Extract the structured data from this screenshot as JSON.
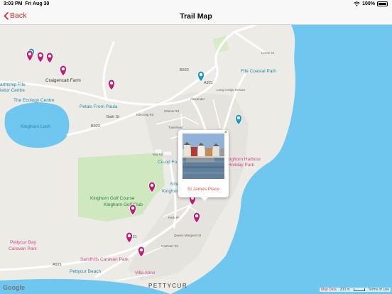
{
  "status": {
    "time": "3:03 PM",
    "date": "Fri Aug 30",
    "battery": "100%"
  },
  "nav": {
    "back_label": "Back",
    "title": "Trail Map"
  },
  "map": {
    "labels": {
      "craigencalt": "Craigencalt Farm",
      "earthship": "arthship Fife",
      "visitor": "isitor Centre",
      "ecology": "The Ecology Centre",
      "petals": "Petals From Paula",
      "loch": "Kinghorn Loch",
      "fife_coastal": "Fife Coastal Path",
      "coop": "Co-op Fo",
      "harbour1": "Kinghorn Harbour",
      "harbour2": "Holiday Park",
      "kinghorn_partial": "Kingh",
      "kinghorn_beach": "Kinghorn Bea",
      "golf_course": "Kinghorn Golf Course",
      "golf_club": "Kinghorn Golf Club",
      "pettycur_bay1": "Pettycur Bay",
      "pettycur_bay2": "Caravan Park",
      "sandhills": "Sandhills Caravan Park",
      "pettycur_beach": "Pettycur Beach",
      "villa": "Villa Atina",
      "pettycur_town": "PETTYCUR",
      "b923_a": "B923",
      "b923_b": "B923",
      "bath_st": "Bath St",
      "a921_a": "A921",
      "a921_b": "A921",
      "a921_c": "A921",
      "links_st": "Linton Ct",
      "long_craigs": "Long Craigs Terrace",
      "kirk_rd": "Kilncraig Rd",
      "mid_rd": "Mid Rd",
      "park_pl": "Park Pl",
      "queen_margaret": "Queen Margaret St",
      "carthcart": "Cathcart Ter",
      "glamis_rd": "Glamis Rd",
      "townhead": "Townhead",
      "alexander": "Alexander"
    }
  },
  "popup": {
    "caption": "St James Place",
    "close_symbol": "×"
  },
  "attribution": {
    "google": "Google",
    "map_data": "Map Data",
    "scale": "200 m",
    "terms": "Terms of Use"
  },
  "colors": {
    "accent": "#e0262a",
    "sea": "#6fc6ef",
    "pin_magenta": "#c41a73",
    "pin_teal": "#2196c9",
    "green_area": "#cfe8c0"
  }
}
